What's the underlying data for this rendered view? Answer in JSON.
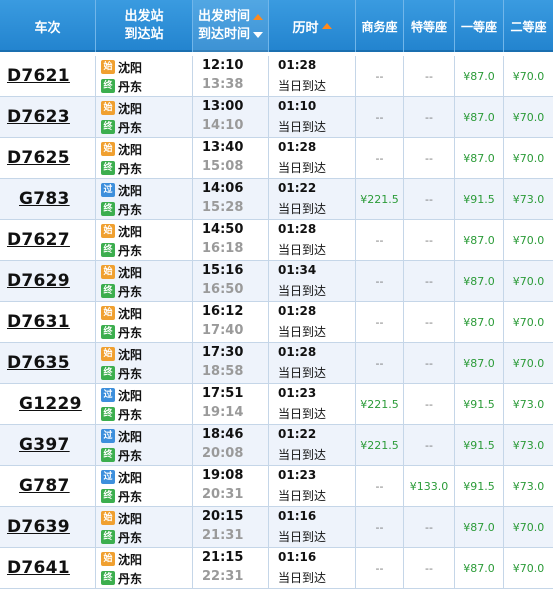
{
  "header": {
    "train": "车次",
    "station_top": "出发站",
    "station_bottom": "到达站",
    "time_top": "出发时间",
    "time_bottom": "到达时间",
    "duration": "历时",
    "business": "商务座",
    "premium": "特等座",
    "first": "一等座",
    "second": "二等座"
  },
  "icons": {
    "start_glyph": "始",
    "pass_glyph": "过",
    "end_glyph": "终"
  },
  "colors": {
    "header_blue": "#2384cf",
    "price_green": "#2b9b38",
    "sort_orange": "#ff8a1c"
  },
  "rows": [
    {
      "train": "D7621",
      "from": "沈阳",
      "to": "丹东",
      "from_type": "始",
      "dep": "12:10",
      "arr": "13:38",
      "dur": "01:28",
      "arrive": "当日到达",
      "business": "--",
      "premium": "--",
      "first": "¥87.0",
      "second": "¥70.0"
    },
    {
      "train": "D7623",
      "from": "沈阳",
      "to": "丹东",
      "from_type": "始",
      "dep": "13:00",
      "arr": "14:10",
      "dur": "01:10",
      "arrive": "当日到达",
      "business": "--",
      "premium": "--",
      "first": "¥87.0",
      "second": "¥70.0"
    },
    {
      "train": "D7625",
      "from": "沈阳",
      "to": "丹东",
      "from_type": "始",
      "dep": "13:40",
      "arr": "15:08",
      "dur": "01:28",
      "arrive": "当日到达",
      "business": "--",
      "premium": "--",
      "first": "¥87.0",
      "second": "¥70.0"
    },
    {
      "train": "G783",
      "from": "沈阳",
      "to": "丹东",
      "from_type": "过",
      "dep": "14:06",
      "arr": "15:28",
      "dur": "01:22",
      "arrive": "当日到达",
      "business": "¥221.5",
      "premium": "--",
      "first": "¥91.5",
      "second": "¥73.0"
    },
    {
      "train": "D7627",
      "from": "沈阳",
      "to": "丹东",
      "from_type": "始",
      "dep": "14:50",
      "arr": "16:18",
      "dur": "01:28",
      "arrive": "当日到达",
      "business": "--",
      "premium": "--",
      "first": "¥87.0",
      "second": "¥70.0"
    },
    {
      "train": "D7629",
      "from": "沈阳",
      "to": "丹东",
      "from_type": "始",
      "dep": "15:16",
      "arr": "16:50",
      "dur": "01:34",
      "arrive": "当日到达",
      "business": "--",
      "premium": "--",
      "first": "¥87.0",
      "second": "¥70.0"
    },
    {
      "train": "D7631",
      "from": "沈阳",
      "to": "丹东",
      "from_type": "始",
      "dep": "16:12",
      "arr": "17:40",
      "dur": "01:28",
      "arrive": "当日到达",
      "business": "--",
      "premium": "--",
      "first": "¥87.0",
      "second": "¥70.0"
    },
    {
      "train": "D7635",
      "from": "沈阳",
      "to": "丹东",
      "from_type": "始",
      "dep": "17:30",
      "arr": "18:58",
      "dur": "01:28",
      "arrive": "当日到达",
      "business": "--",
      "premium": "--",
      "first": "¥87.0",
      "second": "¥70.0"
    },
    {
      "train": "G1229",
      "from": "沈阳",
      "to": "丹东",
      "from_type": "过",
      "dep": "17:51",
      "arr": "19:14",
      "dur": "01:23",
      "arrive": "当日到达",
      "business": "¥221.5",
      "premium": "--",
      "first": "¥91.5",
      "second": "¥73.0"
    },
    {
      "train": "G397",
      "from": "沈阳",
      "to": "丹东",
      "from_type": "过",
      "dep": "18:46",
      "arr": "20:08",
      "dur": "01:22",
      "arrive": "当日到达",
      "business": "¥221.5",
      "premium": "--",
      "first": "¥91.5",
      "second": "¥73.0"
    },
    {
      "train": "G787",
      "from": "沈阳",
      "to": "丹东",
      "from_type": "过",
      "dep": "19:08",
      "arr": "20:31",
      "dur": "01:23",
      "arrive": "当日到达",
      "business": "--",
      "premium": "¥133.0",
      "first": "¥91.5",
      "second": "¥73.0"
    },
    {
      "train": "D7639",
      "from": "沈阳",
      "to": "丹东",
      "from_type": "始",
      "dep": "20:15",
      "arr": "21:31",
      "dur": "01:16",
      "arrive": "当日到达",
      "business": "--",
      "premium": "--",
      "first": "¥87.0",
      "second": "¥70.0"
    },
    {
      "train": "D7641",
      "from": "沈阳",
      "to": "丹东",
      "from_type": "始",
      "dep": "21:15",
      "arr": "22:31",
      "dur": "01:16",
      "arrive": "当日到达",
      "business": "--",
      "premium": "--",
      "first": "¥87.0",
      "second": "¥70.0"
    }
  ]
}
